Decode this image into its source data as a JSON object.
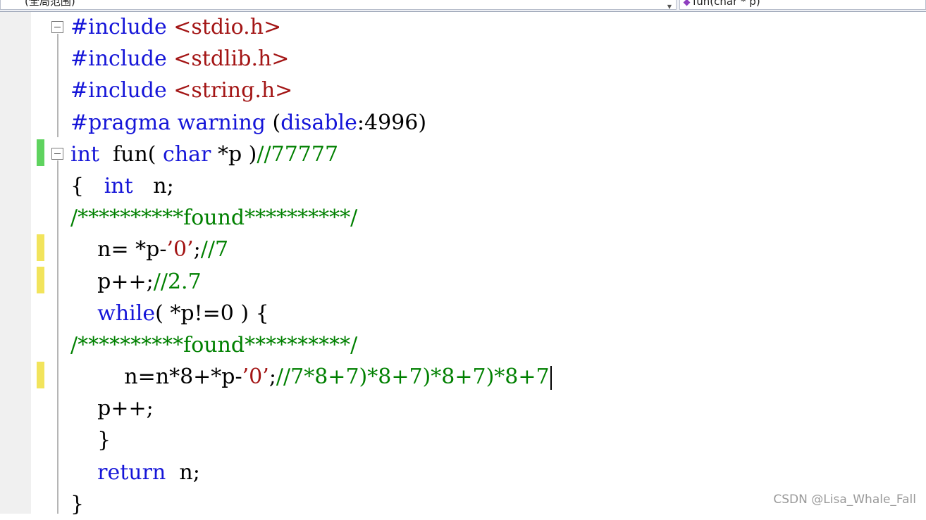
{
  "scope_bar": {
    "left_label": "(全局范围)",
    "right_label": "fun(char * p)"
  },
  "code": {
    "lines": [
      {
        "tokens": [
          {
            "t": "kw",
            "v": "#include "
          },
          {
            "t": "str",
            "v": "<stdio.h>"
          }
        ]
      },
      {
        "tokens": [
          {
            "t": "kw",
            "v": "#include "
          },
          {
            "t": "str",
            "v": "<stdlib.h>"
          }
        ]
      },
      {
        "tokens": [
          {
            "t": "kw",
            "v": "#include "
          },
          {
            "t": "str",
            "v": "<string.h>"
          }
        ]
      },
      {
        "tokens": [
          {
            "t": "kw",
            "v": "#pragma warning "
          },
          {
            "t": "plain",
            "v": "("
          },
          {
            "t": "kw",
            "v": "disable"
          },
          {
            "t": "plain",
            "v": ":4996)"
          }
        ]
      },
      {
        "tokens": [
          {
            "t": "kw",
            "v": "int"
          },
          {
            "t": "plain",
            "v": "  fun( "
          },
          {
            "t": "kw",
            "v": "char"
          },
          {
            "t": "plain",
            "v": " *p )"
          },
          {
            "t": "cm",
            "v": "//77777"
          }
        ]
      },
      {
        "tokens": [
          {
            "t": "plain",
            "v": "{   "
          },
          {
            "t": "kw",
            "v": "int"
          },
          {
            "t": "plain",
            "v": "   n;"
          }
        ]
      },
      {
        "tokens": [
          {
            "t": "cm",
            "v": "/**********found**********/"
          }
        ]
      },
      {
        "tokens": [
          {
            "t": "plain",
            "v": "    n= *p-"
          },
          {
            "t": "str",
            "v": "’0’"
          },
          {
            "t": "plain",
            "v": ";"
          },
          {
            "t": "cm",
            "v": "//7"
          }
        ]
      },
      {
        "tokens": [
          {
            "t": "plain",
            "v": "    p++;"
          },
          {
            "t": "cm",
            "v": "//2.7"
          }
        ]
      },
      {
        "tokens": [
          {
            "t": "plain",
            "v": "    "
          },
          {
            "t": "kw",
            "v": "while"
          },
          {
            "t": "plain",
            "v": "( *p!=0 ) {"
          }
        ]
      },
      {
        "tokens": [
          {
            "t": "cm",
            "v": "/**********found**********/"
          }
        ]
      },
      {
        "tokens": [
          {
            "t": "plain",
            "v": "        n=n*8+*p-"
          },
          {
            "t": "str",
            "v": "’0’"
          },
          {
            "t": "plain",
            "v": ";"
          },
          {
            "t": "cm",
            "v": "//7*8+7)*8+7)*8+7)*8+7"
          }
        ],
        "caret": true
      },
      {
        "tokens": [
          {
            "t": "plain",
            "v": "    p++;"
          }
        ]
      },
      {
        "tokens": [
          {
            "t": "plain",
            "v": "    }"
          }
        ]
      },
      {
        "tokens": [
          {
            "t": "plain",
            "v": "    "
          },
          {
            "t": "kw",
            "v": "return"
          },
          {
            "t": "plain",
            "v": "  n;"
          }
        ]
      },
      {
        "tokens": [
          {
            "t": "plain",
            "v": "}"
          }
        ]
      }
    ]
  },
  "change_marks": [
    {
      "line": 5,
      "color": "green"
    },
    {
      "line": 8,
      "color": "yellow"
    },
    {
      "line": 9,
      "color": "yellow"
    },
    {
      "line": 12,
      "color": "yellow"
    }
  ],
  "colors": {
    "keyword": "#1515d8",
    "string": "#a31515",
    "comment": "#008000",
    "saved_change": "#5fd35f",
    "unsaved_change": "#f2e45c"
  },
  "watermark": "CSDN @Lisa_Whale_Fall"
}
